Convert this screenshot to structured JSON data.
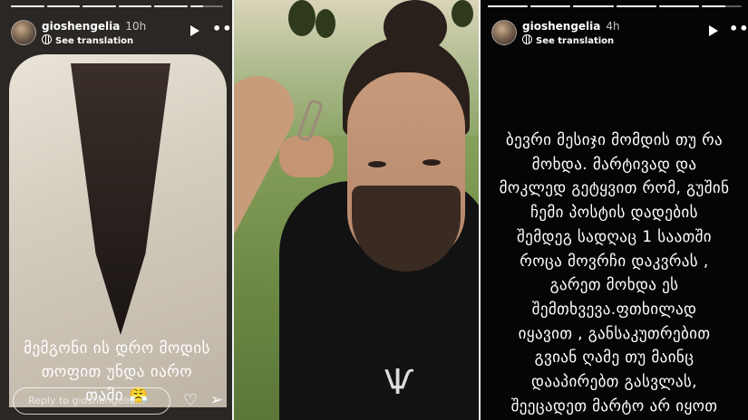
{
  "stories": {
    "left": {
      "username": "gioshengelia",
      "time": "10h",
      "see_translation": "See translation",
      "caption_line1": "მემგონი ის დრო მოდის",
      "caption_line2": "თოფით უნდა იარო",
      "caption_line3": "თამი 😤",
      "reply_placeholder": "Reply to gioshengelia...",
      "progress_segments": 6,
      "progress_current_index": 5,
      "progress_fill": 0.4
    },
    "right": {
      "username": "gioshengelia",
      "time": "4h",
      "see_translation": "See translation",
      "body_lines": [
        "ბევრი მესიჯი მომდის თუ რა",
        "მოხდა. მარტივად და",
        "მოკლედ გეტყვით რომ, გუშინ",
        "ჩემი პოსტის დადების",
        "შემდეგ სადღაც 1 საათში",
        "როცა მოვრჩი დაკვრას ,",
        "გარეთ მოხდა ეს",
        "შემთხვევა.ფთხილად",
        "იყავით , განსაკუთრებით",
        "გვიან ღამე თუ მაინც",
        "დააპირებთ გასვლას,",
        "შეეცადეთ მარტო არ იყოთ"
      ],
      "progress_segments": 6,
      "progress_current_index": 5,
      "progress_fill": 0.6
    }
  },
  "icons": {
    "play": "play-icon",
    "more": "more-icon",
    "heart": "heart-icon",
    "send": "send-icon",
    "globe": "globe-icon"
  },
  "glyphs": {
    "more": "•••",
    "heart": "♡",
    "send": "➢",
    "emblem": "Ѱ"
  },
  "colors": {
    "story_bg_right": "#050505",
    "text": "#ffffff",
    "divider": "#f1f1f1"
  }
}
